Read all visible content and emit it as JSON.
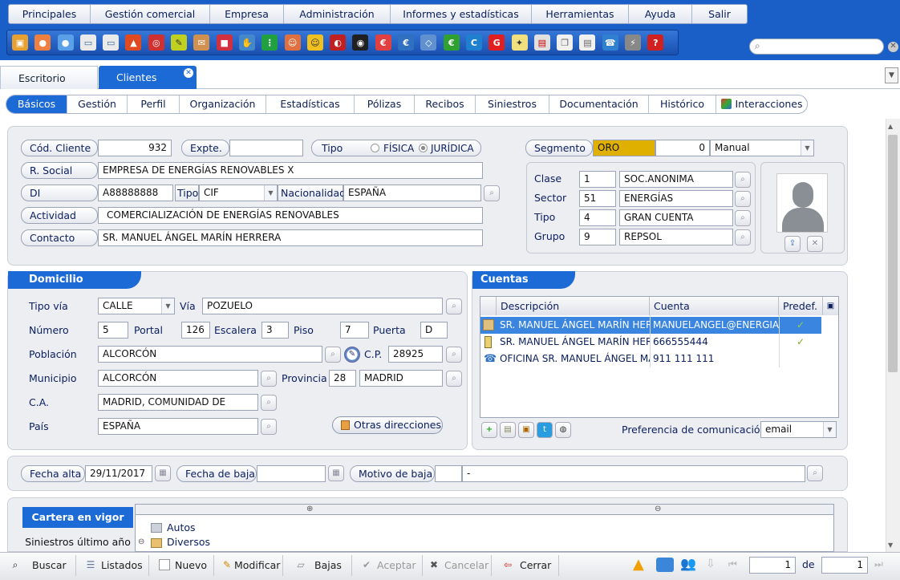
{
  "menu": [
    "Principales",
    "Gestión comercial",
    "Empresa",
    "Administración",
    "Informes y estadísticas",
    "Herramientas",
    "Ayuda",
    "Salir"
  ],
  "toolbar_icons": [
    "box-icon",
    "user-icon",
    "user-icon",
    "window-icon",
    "window-icon",
    "flame-icon",
    "target-icon",
    "pencil-icon",
    "envelope-icon",
    "briefcase-icon",
    "handshake-icon",
    "traffic-light-icon",
    "person-icon",
    "bulb-person-icon",
    "globe-icon",
    "chart-icon",
    "euro-icon",
    "refresh-icon",
    "euro-icon",
    "c-icon",
    "g-icon",
    "lightbulb-icon",
    "presentation-icon",
    "copy-icon",
    "document-icon",
    "phone-icon",
    "plug-icon",
    "help-icon"
  ],
  "search": {
    "icon": "search-icon"
  },
  "page_tabs": [
    "Escritorio",
    "Clientes"
  ],
  "subtabs": [
    "Básicos",
    "Gestión",
    "Perfil",
    "Organización",
    "Estadísticas",
    "Pólizas",
    "Recibos",
    "Siniestros",
    "Documentación",
    "Histórico",
    "Interacciones"
  ],
  "cliente": {
    "cod_label": "Cód. Cliente",
    "cod": "932",
    "expte_label": "Expte.",
    "expte": "",
    "tipo_label": "Tipo",
    "fisica": "FÍSICA",
    "juridica": "JURÍDICA",
    "rsocial_label": "R. Social",
    "rsocial": "EMPRESA DE ENERGÍAS RENOVABLES X",
    "di_label": "DI",
    "di": "A88888888",
    "di_tipo_label": "Tipo",
    "di_tipo": "CIF",
    "nac_label": "Nacionalidad",
    "nac": "ESPAÑA",
    "actividad_label": "Actividad",
    "actividad": "COMERCIALIZACIÓN DE ENERGÍAS RENOVABLES",
    "contacto_label": "Contacto",
    "contacto": "SR. MANUEL ÁNGEL MARÍN HERRERA",
    "segmento_label": "Segmento",
    "segmento": "ORO",
    "segmento_num": "0",
    "segmento_mode": "Manual",
    "segmento_color": "#e0b000"
  },
  "clasif": [
    {
      "label": "Clase",
      "code": "1",
      "value": "SOC.ANONIMA"
    },
    {
      "label": "Sector",
      "code": "51",
      "value": "ENERGÍAS"
    },
    {
      "label": "Tipo",
      "code": "4",
      "value": "GRAN CUENTA"
    },
    {
      "label": "Grupo",
      "code": "9",
      "value": "REPSOL"
    }
  ],
  "domicilio": {
    "title": "Domicilio",
    "tipovia_label": "Tipo vía",
    "tipovia": "CALLE",
    "via_label": "Vía",
    "via": "POZUELO",
    "numero_label": "Número",
    "numero": "5",
    "portal_label": "Portal",
    "portal": "126",
    "escalera_label": "Escalera",
    "escalera": "3",
    "piso_label": "Piso",
    "piso": "7",
    "puerta_label": "Puerta",
    "puerta": "D",
    "poblacion_label": "Población",
    "poblacion": "ALCORCÓN",
    "cp_label": "C.P.",
    "cp": "28925",
    "municipio_label": "Municipio",
    "municipio": "ALCORCÓN",
    "provincia_label": "Provincia",
    "provincia_code": "28",
    "provincia": "MADRID",
    "ca_label": "C.A.",
    "ca": "MADRID, COMUNIDAD DE",
    "pais_label": "País",
    "pais": "ESPAÑA",
    "otras_label": "Otras direcciones"
  },
  "cuentas": {
    "title": "Cuentas",
    "headers": [
      "Descripción",
      "Cuenta",
      "Predef."
    ],
    "rows": [
      {
        "icon": "email-icon",
        "desc": "SR. MANUEL ÁNGEL MARÍN HERRERA",
        "cuenta": "MANUELANGEL@ENERGIASRENOVABLES",
        "predef": "✓"
      },
      {
        "icon": "mobile-icon",
        "desc": "SR. MANUEL ÁNGEL MARÍN HERRERA",
        "cuenta": "666555444",
        "predef": "✓"
      },
      {
        "icon": "phone-icon",
        "desc": "OFICINA SR. MANUEL ÁNGEL MARÍN",
        "cuenta": "911 111 111",
        "predef": ""
      }
    ],
    "pref_label": "Preferencia de comunicación",
    "pref": "email"
  },
  "baja": {
    "alta_label": "Fecha alta",
    "alta": "29/11/2017",
    "baja_label": "Fecha de baja",
    "baja": "",
    "motivo_label": "Motivo de baja",
    "motivo_code": "",
    "motivo": "-"
  },
  "cartera": {
    "tabs": [
      "Cartera en vigor",
      "Siniestros último año"
    ],
    "items": [
      "Autos",
      "Diversos"
    ]
  },
  "bottom": {
    "buscar": "Buscar",
    "listados": "Listados",
    "nuevo": "Nuevo",
    "modificar": "Modificar",
    "bajas": "Bajas",
    "aceptar": "Aceptar",
    "cancelar": "Cancelar",
    "cerrar": "Cerrar",
    "page": "1",
    "de": "de",
    "total": "1"
  }
}
